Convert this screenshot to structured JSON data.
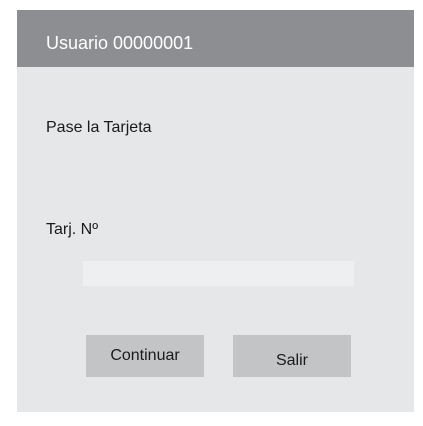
{
  "window": {
    "title": "Usuario 00000001"
  },
  "form": {
    "prompt": "Pase la Tarjeta",
    "card_label": "Tarj. Nº",
    "card_value": "",
    "card_placeholder": ""
  },
  "buttons": {
    "continue_label": "Continuar",
    "exit_label": "Salir"
  },
  "colors": {
    "title_bar": "#8c8e91",
    "dialog_background": "#e6e7e9",
    "input_background": "#eeeff0",
    "button_background": "#c3c4c6"
  }
}
